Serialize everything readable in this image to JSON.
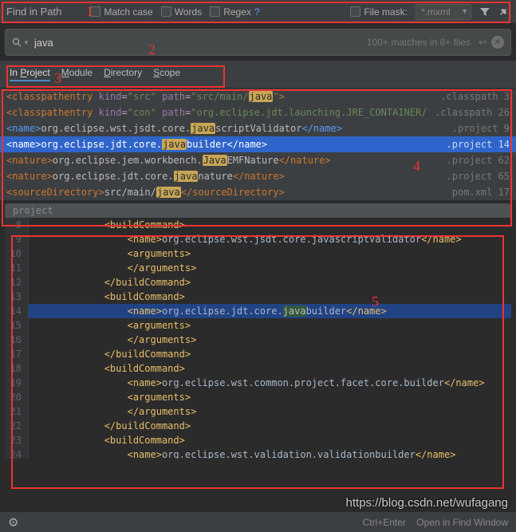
{
  "title": "Find in Path",
  "checkboxes": {
    "match_case": "Match case",
    "words": "Words",
    "regex": "Regex",
    "file_mask": "File mask:"
  },
  "file_mask_value": "*.mxml",
  "search_value": "java",
  "match_info": "100+ matches in 8+ files",
  "tabs": [
    "In Project",
    "Module",
    "Directory",
    "Scope"
  ],
  "results": [
    {
      "idx": 0,
      "html": "<span class='tag'>&lt;classpathentry</span> <span class='attr'>kind</span>=<span class='str'>\"src\"</span> <span class='attr'>path</span>=<span class='str'>\"src/main/<span class='hl'>java</span>\"</span><span class='tag'>&gt;</span>",
      "file": ".classpath",
      "line": "3"
    },
    {
      "idx": 1,
      "html": "<span class='tag'>&lt;classpathentry</span> <span class='attr'>kind</span>=<span class='str'>\"con\"</span> <span class='attr'>path</span>=<span class='str'>\"org.eclipse.jdt.launching.JRE_CONTAINER/org.eclipse.jdt.in</span>",
      "file": ".classpath",
      "line": "26"
    },
    {
      "idx": 2,
      "html": "<span class='blue'>&lt;name&gt;</span><span class='txt'>org.eclipse.wst.jsdt.core.</span><span class='hl'>java</span><span class='txt'>scriptValidator</span><span class='blue'>&lt;/name&gt;</span>",
      "file": ".project",
      "line": "9"
    },
    {
      "idx": 3,
      "selected": true,
      "html": "&lt;name&gt;org.eclipse.jdt.core.<span class='hl'>java</span>builder&lt;/name&gt;",
      "file": ".project",
      "line": "14"
    },
    {
      "idx": 4,
      "html": "<span class='tag'>&lt;nature&gt;</span><span class='txt'>org.eclipse.jem.workbench.</span><span class='hl'>Java</span><span class='txt'>EMFNature</span><span class='tag'>&lt;/nature&gt;</span>",
      "file": ".project",
      "line": "62"
    },
    {
      "idx": 5,
      "html": "<span class='tag'>&lt;nature&gt;</span><span class='txt'>org.eclipse.jdt.core.</span><span class='hl'>java</span><span class='txt'>nature</span><span class='tag'>&lt;/nature&gt;</span>",
      "file": ".project",
      "line": "65"
    },
    {
      "idx": 6,
      "html": "<span class='tag'>&lt;sourceDirectory&gt;</span><span class='txt'>src/main/</span><span class='hl'>java</span><span class='tag'>&lt;/sourceDirectory&gt;</span>",
      "file": "pom.xml",
      "line": "17"
    }
  ],
  "preview_file": "project",
  "preview_lines": [
    {
      "n": "8",
      "indent": 3,
      "html": "<span class='yellow-tag'>&lt;buildCommand&gt;</span>"
    },
    {
      "n": "9",
      "indent": 4,
      "html": "<span class='yellow-tag'>&lt;name&gt;</span><span class='green-txt'>org.eclipse.wst.jsdt.core.javascriptValidator</span><span class='yellow-tag'>&lt;/name&gt;</span>"
    },
    {
      "n": "10",
      "indent": 4,
      "html": "<span class='yellow-tag'>&lt;arguments&gt;</span>"
    },
    {
      "n": "11",
      "indent": 4,
      "html": "<span class='yellow-tag'>&lt;/arguments&gt;</span>"
    },
    {
      "n": "12",
      "indent": 3,
      "html": "<span class='yellow-tag'>&lt;/buildCommand&gt;</span>"
    },
    {
      "n": "13",
      "indent": 3,
      "html": "<span class='yellow-tag'>&lt;buildCommand&gt;</span>"
    },
    {
      "n": "14",
      "indent": 4,
      "caret": true,
      "html": "<span class='yellow-tag'>&lt;name&gt;</span><span class='green-txt'>org.eclipse.jdt.core.</span><span class='cur-hl'>java</span><span class='green-txt'>builder</span><span class='yellow-tag'>&lt;/name&gt;</span>"
    },
    {
      "n": "15",
      "indent": 4,
      "html": "<span class='yellow-tag'>&lt;arguments&gt;</span>"
    },
    {
      "n": "16",
      "indent": 4,
      "html": "<span class='yellow-tag'>&lt;/arguments&gt;</span>"
    },
    {
      "n": "17",
      "indent": 3,
      "html": "<span class='yellow-tag'>&lt;/buildCommand&gt;</span>"
    },
    {
      "n": "18",
      "indent": 3,
      "html": "<span class='yellow-tag'>&lt;buildCommand&gt;</span>"
    },
    {
      "n": "19",
      "indent": 4,
      "html": "<span class='yellow-tag'>&lt;name&gt;</span><span class='green-txt'>org.eclipse.wst.common.project.facet.core.builder</span><span class='yellow-tag'>&lt;/name&gt;</span>"
    },
    {
      "n": "20",
      "indent": 4,
      "html": "<span class='yellow-tag'>&lt;arguments&gt;</span>"
    },
    {
      "n": "21",
      "indent": 4,
      "html": "<span class='yellow-tag'>&lt;/arguments&gt;</span>"
    },
    {
      "n": "22",
      "indent": 3,
      "html": "<span class='yellow-tag'>&lt;/buildCommand&gt;</span>"
    },
    {
      "n": "23",
      "indent": 3,
      "html": "<span class='yellow-tag'>&lt;buildCommand&gt;</span>"
    },
    {
      "n": "24",
      "indent": 4,
      "html": "<span class='yellow-tag'>&lt;name&gt;</span><span class='green-txt'>org.eclipse.wst.validation.validationbuilder</span><span class='yellow-tag'>&lt;/name&gt;</span>"
    }
  ],
  "statusbar": {
    "hint_key": "Ctrl+Enter",
    "hint_text": "Open in Find Window"
  },
  "watermark": "https://blog.csdn.net/wufagang",
  "annotations": [
    "1",
    "2",
    "3",
    "4",
    "5"
  ]
}
